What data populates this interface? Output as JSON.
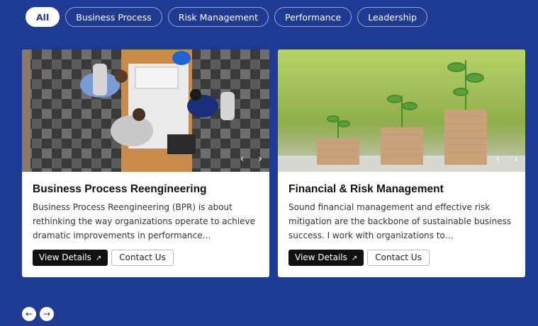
{
  "filters": [
    "All",
    "Business Process",
    "Risk Management",
    "Performance",
    "Leadership"
  ],
  "cards": [
    {
      "title": "Business Process Reengineering",
      "description": "Business Process Reengineering (BPR) is about rethinking the way organizations operate to achieve dramatic improvements in performance…",
      "view_label": "View Details",
      "contact_label": "Contact Us",
      "image": "team-meeting-blueprints-photo"
    },
    {
      "title": "Financial & Risk Management",
      "description": "Sound financial management and effective risk mitigation are the backbone of sustainable business success. I work with organizations to…",
      "view_label": "View Details",
      "contact_label": "Contact Us",
      "image": "plants-growing-on-coin-stacks-photo"
    }
  ],
  "icons": {
    "prev": "‹",
    "next": "›",
    "external": "↗",
    "nav_prev": "←",
    "nav_next": "→"
  },
  "colors": {
    "background": "#1f3a93",
    "button_dark": "#111111"
  }
}
